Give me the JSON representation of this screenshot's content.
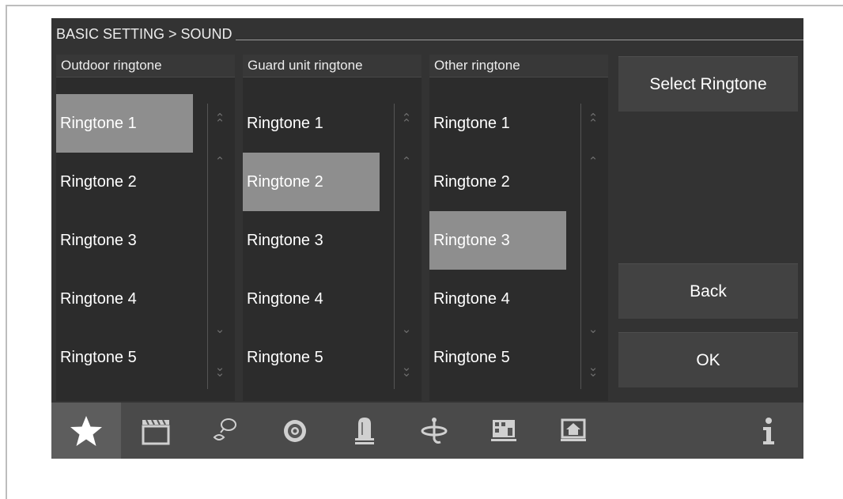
{
  "title": "BASIC SETTING > SOUND",
  "panels": [
    {
      "heading": "Outdoor ringtone",
      "items": [
        "Ringtone 1",
        "Ringtone 2",
        "Ringtone 3",
        "Ringtone 4",
        "Ringtone 5"
      ],
      "selected": "Ringtone 1"
    },
    {
      "heading": "Guard unit ringtone",
      "items": [
        "Ringtone 1",
        "Ringtone 2",
        "Ringtone 3",
        "Ringtone 4",
        "Ringtone 5"
      ],
      "selected": "Ringtone 2"
    },
    {
      "heading": "Other ringtone",
      "items": [
        "Ringtone 1",
        "Ringtone 2",
        "Ringtone 3",
        "Ringtone 4",
        "Ringtone 5"
      ],
      "selected": "Ringtone 3"
    }
  ],
  "buttons": {
    "select_ringtone": "Select Ringtone",
    "back": "Back",
    "ok": "OK"
  },
  "scroll_icons": [
    "double-chevron-up-icon",
    "chevron-up-icon",
    "chevron-down-icon",
    "double-chevron-down-icon"
  ],
  "nav": [
    {
      "icon": "star-icon",
      "active": true
    },
    {
      "icon": "clapperboard-icon",
      "active": false
    },
    {
      "icon": "speech-bubble-icon",
      "active": false
    },
    {
      "icon": "camera-lens-icon",
      "active": false
    },
    {
      "icon": "alarm-light-icon",
      "active": false
    },
    {
      "icon": "satellite-dish-icon",
      "active": false
    },
    {
      "icon": "building-icon",
      "active": false
    },
    {
      "icon": "home-icon",
      "active": false
    },
    {
      "icon": "info-icon",
      "active": false
    }
  ],
  "colors": {
    "screen_bg": "#333333",
    "selected_bg": "#8e8e8e",
    "button_bg": "#424242",
    "navbar_bg": "#4a4a4a"
  }
}
